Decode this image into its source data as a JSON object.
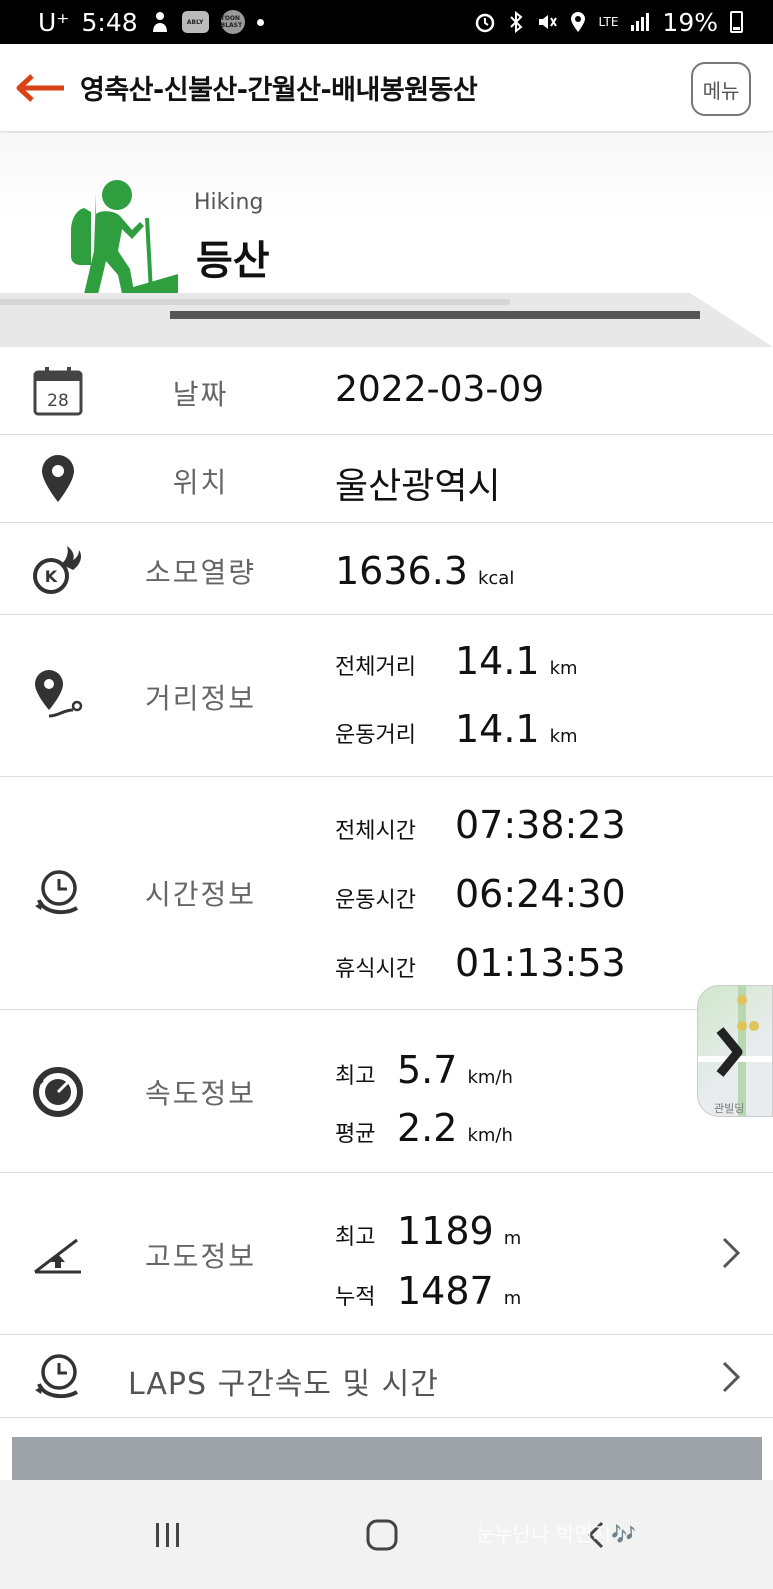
{
  "status_bar": {
    "carrier": "U⁺",
    "time": "5:48",
    "app_icons": [
      "ABLY",
      "TOON BLAST"
    ],
    "network": "LTE",
    "battery": "19%"
  },
  "header": {
    "title": "영축산-신불산-간월산-배내봉원동산",
    "menu_label": "메뉴"
  },
  "activity": {
    "subtitle": "Hiking",
    "title": "등산"
  },
  "rows": {
    "date": {
      "label": "날짜",
      "value": "2022-03-09",
      "calendar_day": "28"
    },
    "location": {
      "label": "위치",
      "value": "울산광역시"
    },
    "calories": {
      "label": "소모열량",
      "value": "1636.3",
      "unit": "kcal"
    },
    "distance": {
      "label": "거리정보",
      "items": [
        {
          "key": "전체거리",
          "value": "14.1",
          "unit": "km"
        },
        {
          "key": "운동거리",
          "value": "14.1",
          "unit": "km"
        }
      ]
    },
    "time": {
      "label": "시간정보",
      "items": [
        {
          "key": "전체시간",
          "value": "07:38:23"
        },
        {
          "key": "운동시간",
          "value": "06:24:30"
        },
        {
          "key": "휴식시간",
          "value": "01:13:53"
        }
      ]
    },
    "speed": {
      "label": "속도정보",
      "items": [
        {
          "key": "최고",
          "value": "5.7",
          "unit": "km/h"
        },
        {
          "key": "평균",
          "value": "2.2",
          "unit": "km/h"
        }
      ]
    },
    "altitude": {
      "label": "고도정보",
      "items": [
        {
          "key": "최고",
          "value": "1189",
          "unit": "m"
        },
        {
          "key": "누적",
          "value": "1487",
          "unit": "m"
        }
      ]
    },
    "laps": {
      "label": "LAPS 구간속도 및 시간"
    }
  },
  "map_tab": {
    "label": "관빌딩"
  },
  "watermark": "눈누난나 박연지🎶",
  "colors": {
    "accent": "#d84315",
    "hiking_green": "#2e9e3e",
    "label_grey": "#666666"
  }
}
